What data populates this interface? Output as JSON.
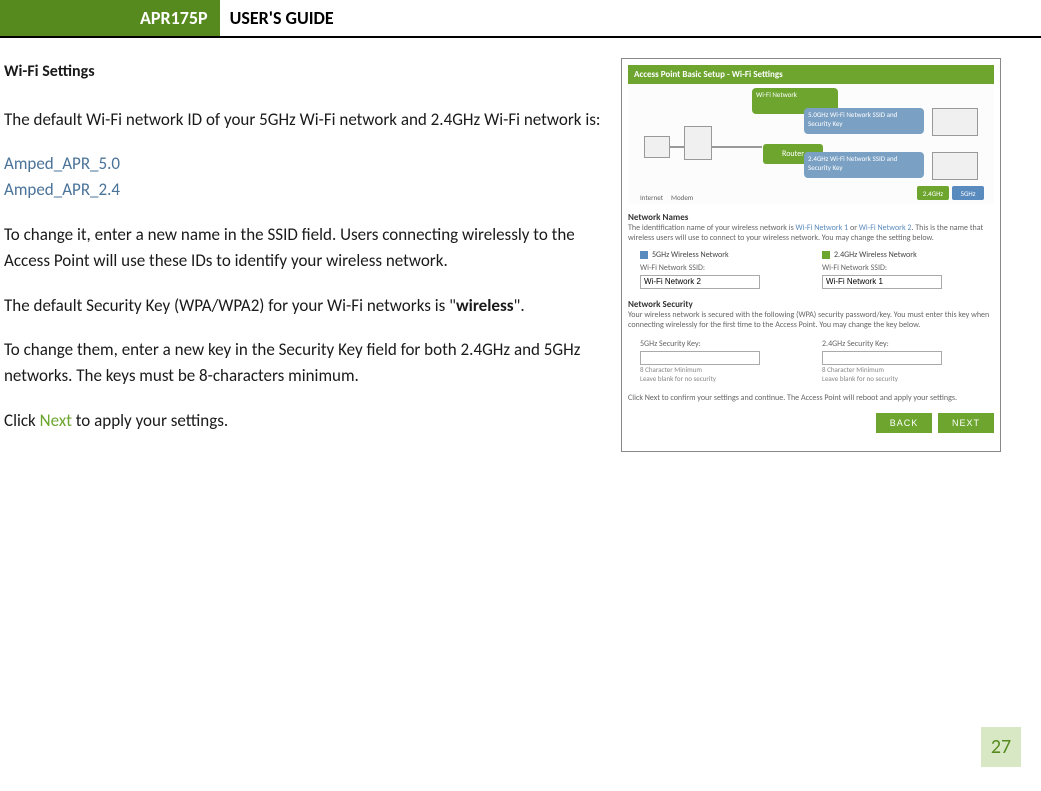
{
  "header": {
    "model": "APR175P",
    "title": "USER'S GUIDE"
  },
  "section_heading": "Wi-Fi Settings",
  "paras": {
    "p1": "The default Wi-Fi network ID of your 5GHz Wi-Fi network and 2.4GHz Wi-Fi network is:",
    "ssid5": "Amped_APR_5.0",
    "ssid24": "Amped_APR_2.4",
    "p2": "To change it, enter a new name in the SSID field.  Users connecting wirelessly to the Access Point will use these IDs to identify your wireless network.",
    "p3a": "The default Security Key (WPA/WPA2) for your Wi-Fi networks is \"",
    "p3b": "wireless",
    "p3c": "\".",
    "p4": "To change them, enter a new key in the Security Key field for both 2.4GHz and 5GHz networks. The keys must be 8-characters minimum.",
    "p5a": "Click ",
    "p5b": "Next",
    "p5c": " to apply your settings."
  },
  "screenshot": {
    "header": "Access Point Basic Setup - Wi-Fi Settings",
    "diagram": {
      "bubble0": "Wi-Fi Network",
      "bubble1": "5.0GHz Wi-Fi Network SSID and Security Key",
      "bubble2": "2.4GHz Wi-Fi Network SSID and Security Key",
      "dev_internet": "Internet",
      "dev_modem": "Modem",
      "dev_router": "Router",
      "pill1": "2.4GHz",
      "pill2": "5GHz"
    },
    "network_names": {
      "title": "Network Names",
      "desc_a": "The identification name of your wireless network is ",
      "desc_b": "Wi-Fi Network 1",
      "desc_c": " or ",
      "desc_d": "Wi-Fi Network 2",
      "desc_e": ". This is the name that wireless users will use to connect to your wireless network. You may change the setting below.",
      "col5": "5GHz Wireless Network",
      "col24": "2.4GHz Wireless Network",
      "ssid_label": "Wi-Fi Network SSID:",
      "ssid5_val": "Wi-Fi Network 2",
      "ssid24_val": "Wi-Fi Network 1"
    },
    "network_security": {
      "title": "Network Security",
      "desc": "Your wireless network is secured with the following (WPA) security password/key. You must enter this key when connecting wirelessly for the first time to the Access Point. You may change the key below.",
      "key5_label": "5GHz Security Key:",
      "key24_label": "2.4GHz Security Key:",
      "hint1": "8 Character Minimum",
      "hint2": "Leave blank for no security"
    },
    "footer_note": "Click Next to confirm your settings and continue. The Access Point will reboot and apply your settings.",
    "btn_back": "BACK",
    "btn_next": "NEXT"
  },
  "page_number": "27"
}
